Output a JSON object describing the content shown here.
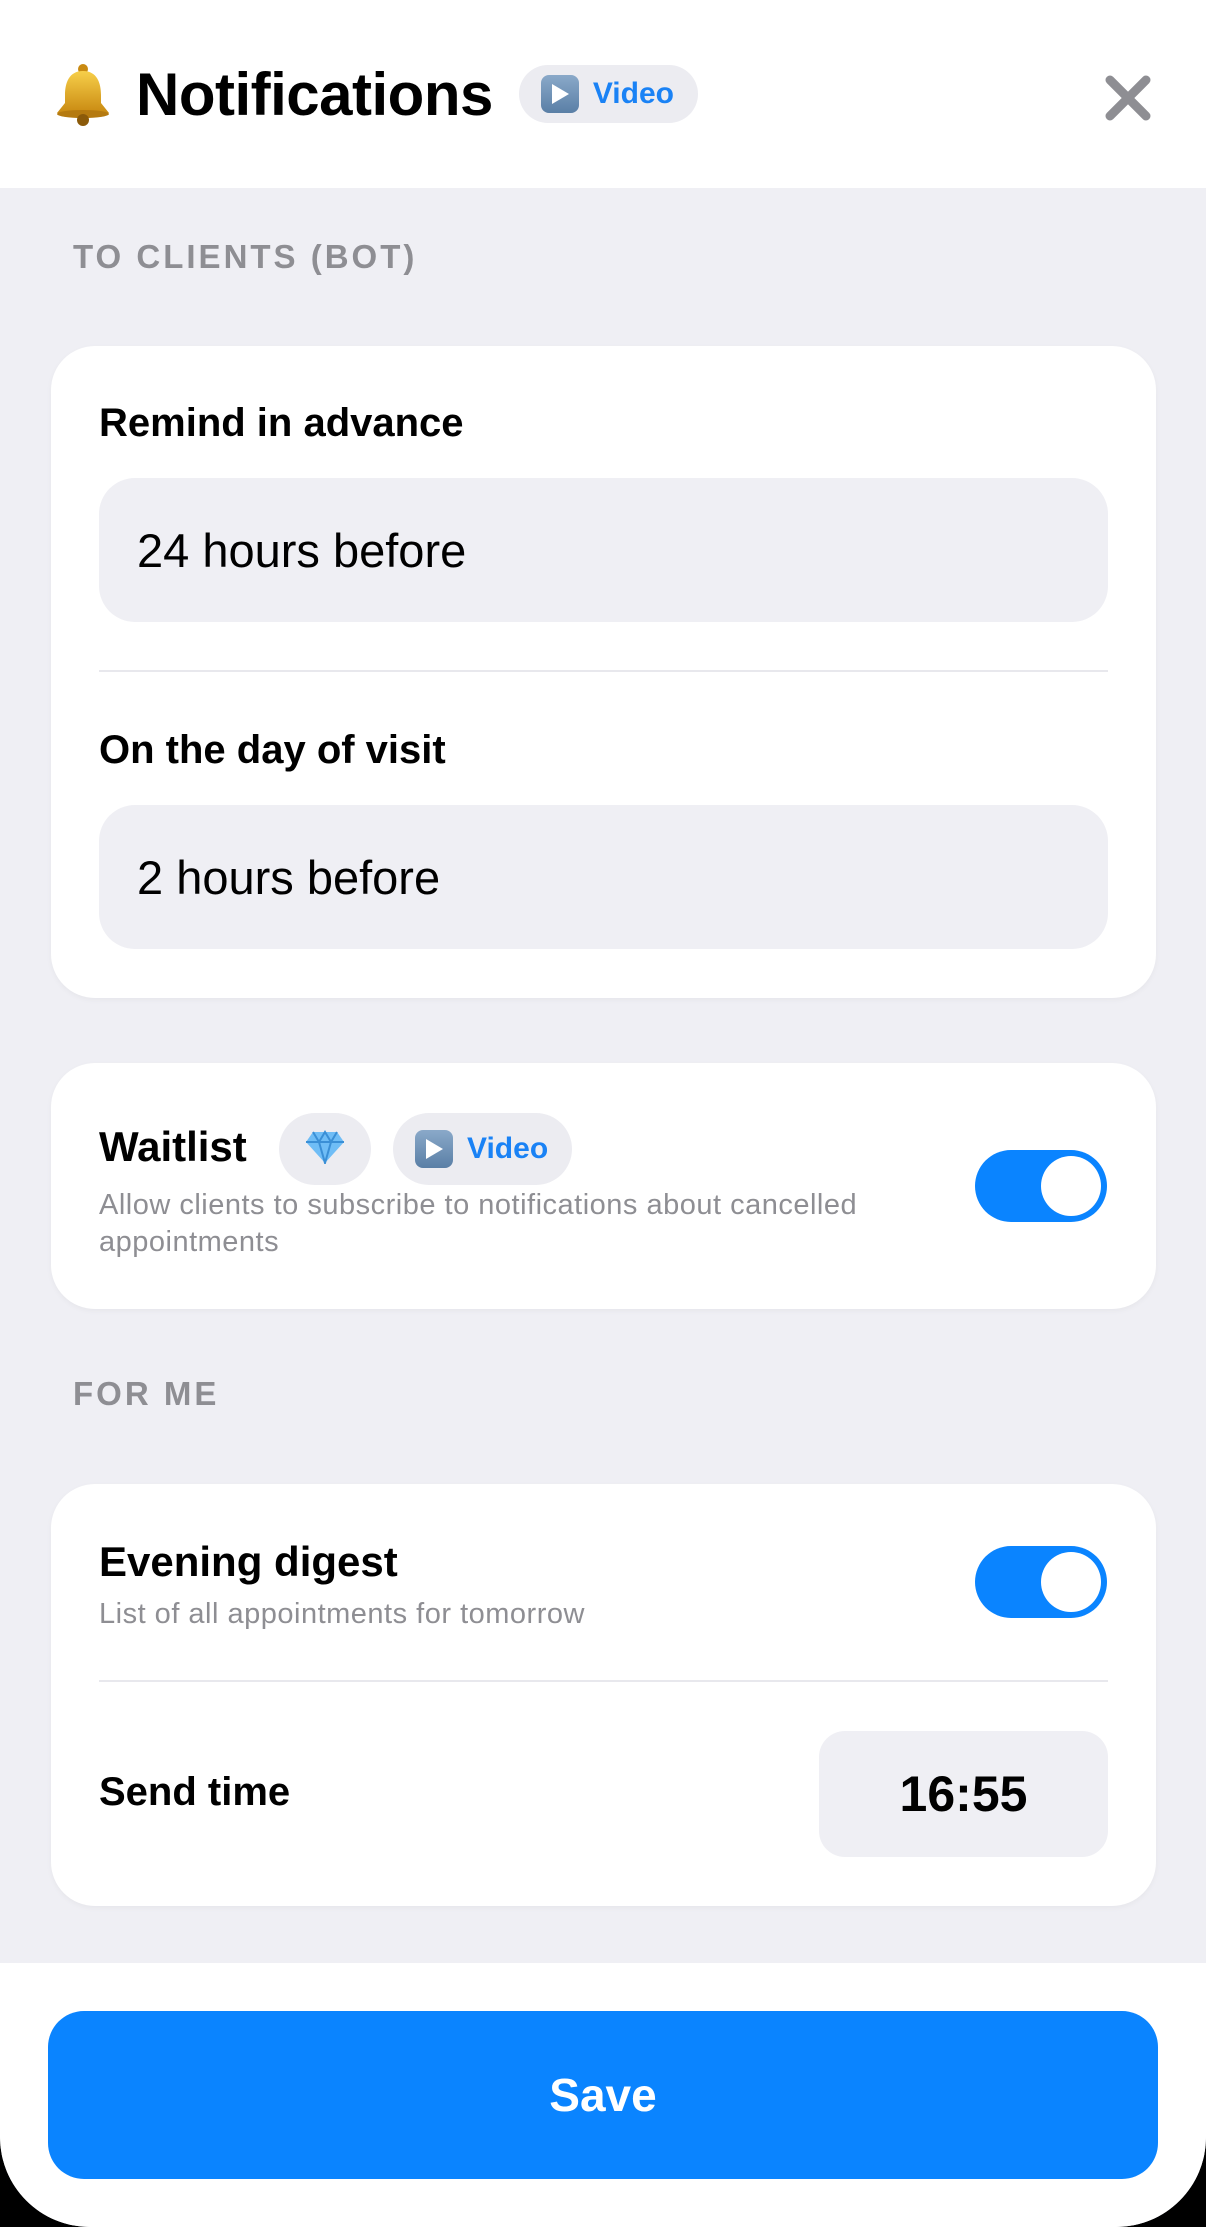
{
  "header": {
    "title": "Notifications",
    "video_label": "Video",
    "icons": {
      "bell": "bell-icon",
      "play": "play-icon",
      "close": "close-icon"
    }
  },
  "sections": {
    "to_clients": "TO CLIENTS (BOT)",
    "for_me": "FOR ME"
  },
  "reminders": {
    "advance_label": "Remind in advance",
    "advance_value": "24 hours before",
    "day_of_label": "On the day of visit",
    "day_of_value": "2 hours before"
  },
  "waitlist": {
    "title": "Waitlist",
    "video_label": "Video",
    "description": "Allow clients to subscribe to notifications about cancelled appointments",
    "enabled": true,
    "icons": {
      "premium": "gem-icon",
      "play": "play-icon"
    }
  },
  "digest": {
    "title": "Evening digest",
    "description": "List of all appointments for tomorrow",
    "enabled": true,
    "send_time_label": "Send time",
    "send_time_value": "16:55"
  },
  "footer": {
    "save_label": "Save"
  },
  "colors": {
    "accent": "#0a84ff",
    "background": "#efeff4",
    "secondary_text": "#8e8e93"
  }
}
